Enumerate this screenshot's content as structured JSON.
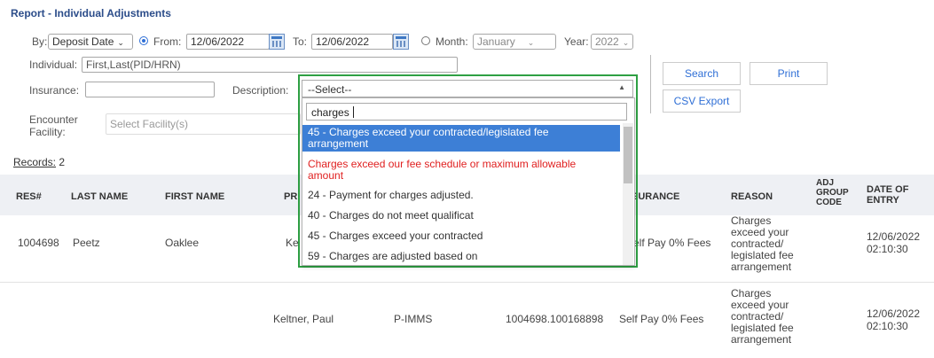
{
  "page": {
    "title": "Report - Individual Adjustments"
  },
  "filters": {
    "by_label": "By:",
    "by_value": "Deposit Date",
    "from_label": "From:",
    "from_value": "12/06/2022",
    "to_label": "To:",
    "to_value": "12/06/2022",
    "month_label": "Month:",
    "month_value": "January",
    "year_label": "Year:",
    "year_value": "2022",
    "individual_label": "Individual:",
    "individual_placeholder": "First,Last(PID/HRN)",
    "insurance_label": "Insurance:",
    "insurance_value": "",
    "description_label": "Description:",
    "description_value": "--Select--",
    "encounter_label_line1": "Encounter",
    "encounter_label_line2": "Facility:",
    "facility_placeholder": "Select Facility(s)"
  },
  "buttons": {
    "search": "Search",
    "print": "Print",
    "csv_export": "CSV Export"
  },
  "records": {
    "label": "Records:",
    "count": "2"
  },
  "dropdown": {
    "search_value": "charges",
    "options": [
      {
        "line1": "45 - Charges exceed your contracted/legislated fee",
        "line2": "arrangement",
        "state": "active"
      },
      {
        "line1": "Charges exceed our fee schedule or maximum allowable",
        "line2": "amount",
        "state": "warn"
      },
      {
        "line1": "24 - Payment for charges adjusted.",
        "line2": "",
        "state": "normal"
      },
      {
        "line1": "40 - Charges do not meet qualificat",
        "line2": "",
        "state": "normal"
      },
      {
        "line1": "45 - Charges exceed your contracted",
        "line2": "",
        "state": "normal"
      },
      {
        "line1": "59 - Charges are adjusted based on",
        "line2": "",
        "state": "normal"
      }
    ]
  },
  "table": {
    "headers": {
      "res": "RES#",
      "last_name": "LAST NAME",
      "first_name": "FIRST NAME",
      "pro_partial": "PR",
      "insurance_partial": "SURANCE",
      "reason": "REASON",
      "adj_group_code": [
        "ADJ",
        "GROUP",
        "CODE"
      ],
      "date_of_entry": [
        "DATE OF",
        "ENTRY"
      ]
    },
    "rows": [
      {
        "res": "1004698",
        "last_name": "Peetz",
        "first_name": "Oaklee",
        "provider": "Ke",
        "program": "",
        "claim": "",
        "insurance": "elf Pay 0% Fees",
        "reason": [
          "Charges",
          "exceed your",
          "contracted/",
          "legislated fee",
          "arrangement"
        ],
        "adj_group_code": "",
        "date": [
          "12/06/2022",
          "02:10:30"
        ]
      },
      {
        "res": "",
        "last_name": "",
        "first_name": "",
        "provider": "Keltner, Paul",
        "program": "P-IMMS",
        "claim": "1004698.100168898",
        "insurance": "Self Pay 0% Fees",
        "reason": [
          "Charges",
          "exceed your",
          "contracted/",
          "legislated fee",
          "arrangement"
        ],
        "adj_group_code": "",
        "date": [
          "12/06/2022",
          "02:10:30"
        ]
      }
    ]
  },
  "colors": {
    "accent": "#2f6fd6",
    "highlight_border": "#2ea043",
    "active_option": "#3d7fd6",
    "warn_text": "#e02020"
  }
}
